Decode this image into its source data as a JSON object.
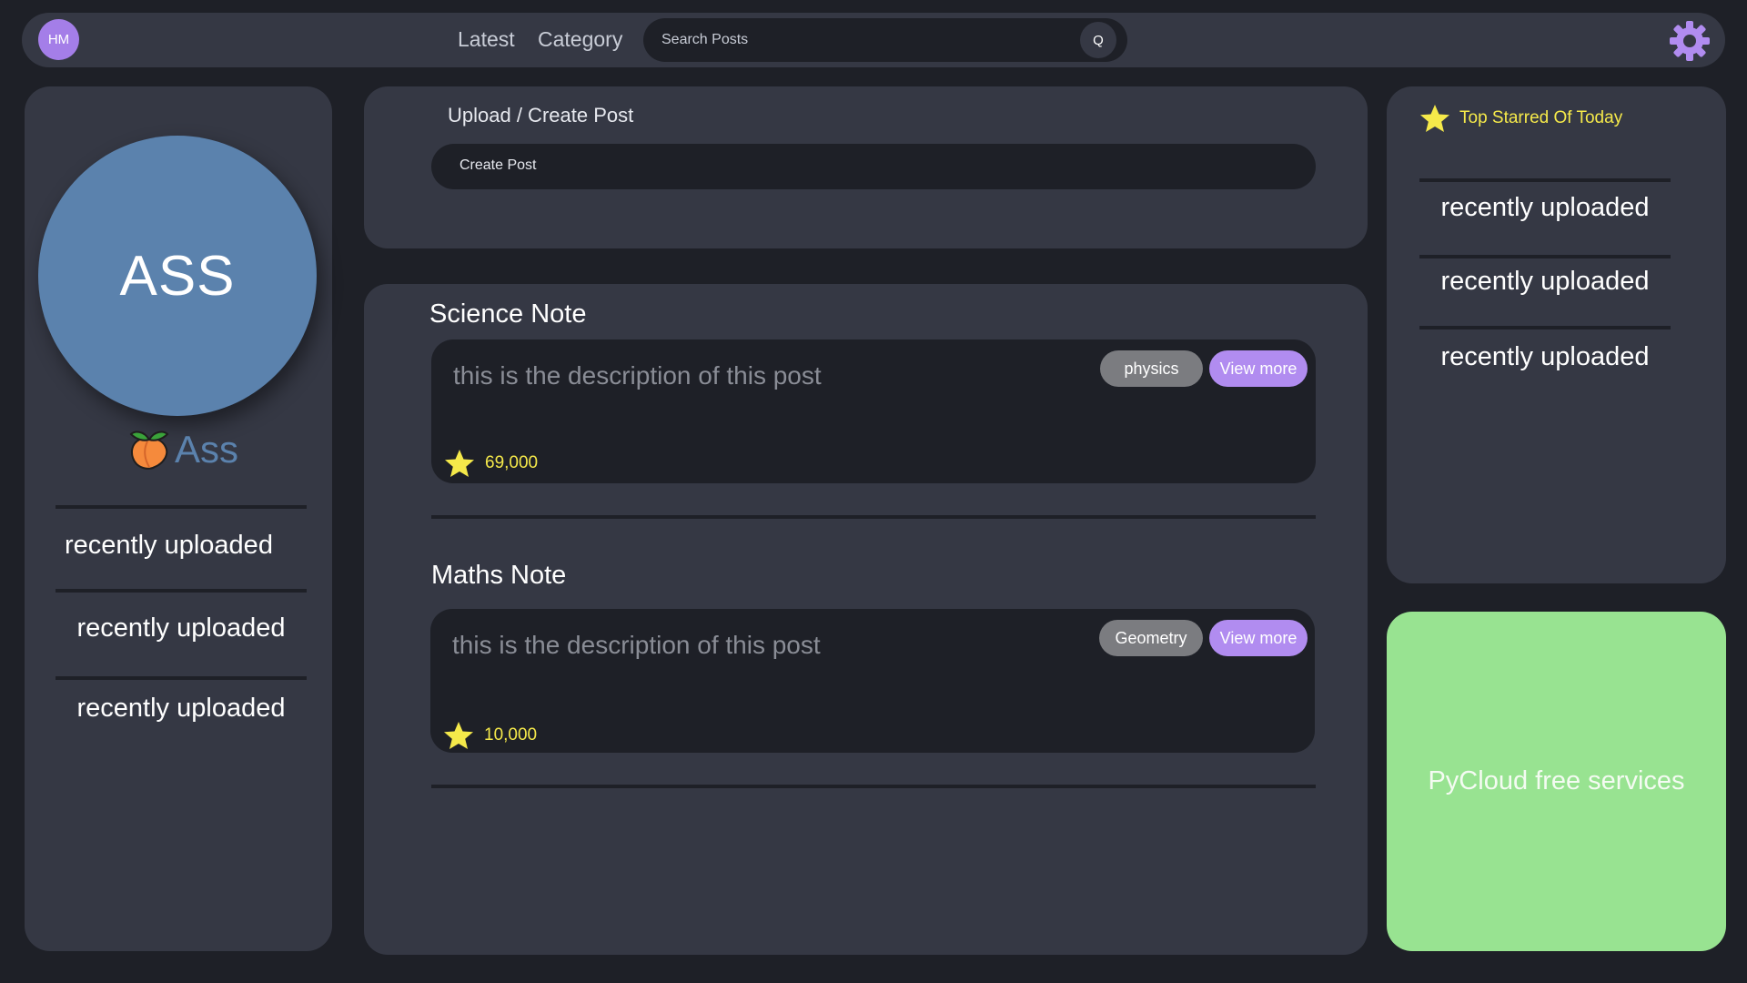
{
  "header": {
    "avatar_initials": "HM",
    "nav": {
      "latest": "Latest",
      "category": "Category"
    },
    "search": {
      "placeholder": "Search Posts",
      "button_label": "Q"
    },
    "settings_icon": "gear-icon"
  },
  "profile": {
    "initials": "ASS",
    "name": "Ass",
    "name_icon": "peach-icon",
    "recent": [
      {
        "label": "recently uploaded"
      },
      {
        "label": "recently uploaded"
      },
      {
        "label": "recently uploaded"
      }
    ]
  },
  "upload": {
    "title": "Upload / Create Post",
    "create_label": "Create Post"
  },
  "posts": [
    {
      "title": "Science Note",
      "description": "this is the description of this post",
      "tag": "physics",
      "view_more": "View more",
      "stars": "69,000"
    },
    {
      "title": "Maths Note",
      "description": "this is the description of this post",
      "tag": "Geometry",
      "view_more": "View more",
      "stars": "10,000"
    }
  ],
  "top_starred": {
    "title": "Top Starred Of Today",
    "items": [
      {
        "label": "recently uploaded"
      },
      {
        "label": "recently uploaded"
      },
      {
        "label": "recently uploaded"
      }
    ]
  },
  "promo": {
    "text": "PyCloud free services"
  },
  "colors": {
    "background": "#1e2027",
    "panel": "#353844",
    "accent_purple": "#b18cf0",
    "profile_blue": "#5b82ad",
    "star_yellow": "#f5e94a",
    "promo_green": "#98e391"
  }
}
